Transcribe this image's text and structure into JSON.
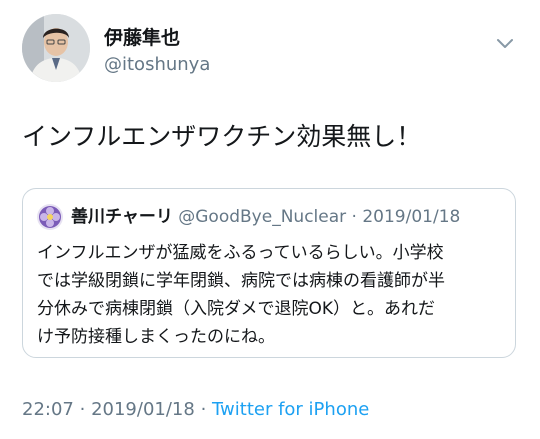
{
  "user": {
    "display_name": "伊藤隼也",
    "handle": "@itoshunya",
    "avatar_icon": "person-avatar-icon"
  },
  "tweet": {
    "text": "インフルエンザワクチン効果無し！"
  },
  "quoted_tweet": {
    "display_name": "善川チャーリ",
    "handle": "@GoodBye_Nuclear",
    "separator": "·",
    "date": "2019/01/18",
    "avatar_icon": "flower-avatar-icon",
    "lines": [
      "インフルエンザが猛威をふるっているらしい。小学校",
      "では学級閉鎖に学年閉鎖、病院では病棟の看護師が半",
      "分休みで病棟閉鎖（入院ダメで退院OK）と。あれだ",
      "け予防接種しまくったのにね。"
    ]
  },
  "meta": {
    "time": "22:07",
    "separator_1": "·",
    "date": "2019/01/18",
    "separator_2": "·",
    "source": "Twitter for iPhone"
  },
  "colors": {
    "text": "#14171a",
    "secondary": "#657786",
    "link": "#1da1f2",
    "border": "#ccd6dd"
  },
  "menu_icon": "chevron-down-icon"
}
